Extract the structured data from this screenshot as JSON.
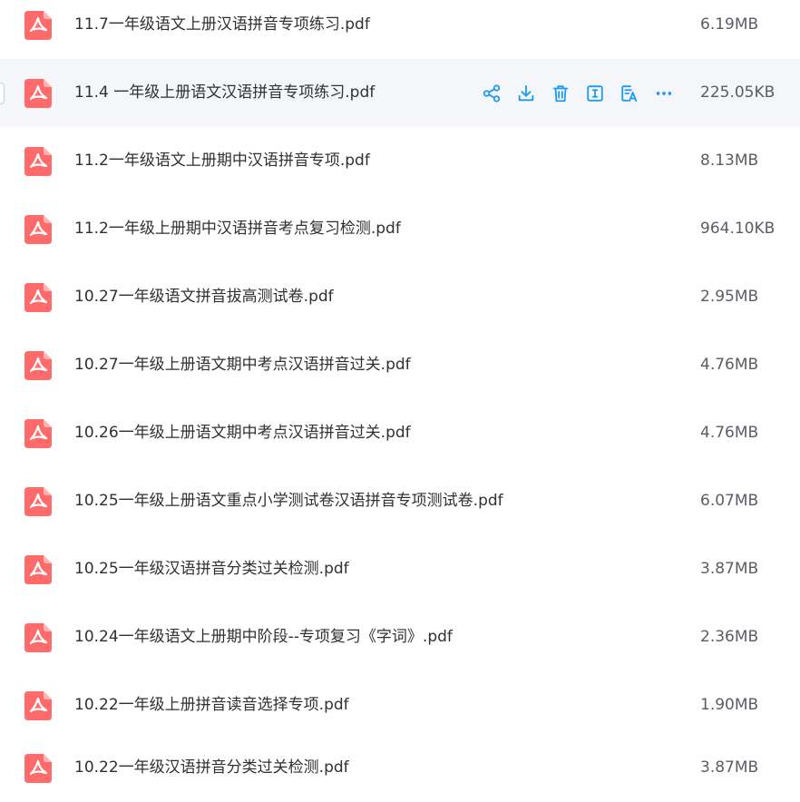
{
  "colors": {
    "pdf_icon": "#ff6b6b",
    "action_icon": "#1e9bf0",
    "hover_row": "#f5f6fa"
  },
  "icons": {
    "file": "pdf-icon",
    "actions": [
      "share-icon",
      "download-icon",
      "delete-icon",
      "rename-icon",
      "text-recognition-icon",
      "more-icon"
    ]
  },
  "files": [
    {
      "name": "11.7一年级语文上册汉语拼音专项练习.pdf",
      "size": "6.19MB"
    },
    {
      "name": "11.4 一年级上册语文汉语拼音专项练习.pdf",
      "size": "225.05KB"
    },
    {
      "name": "11.2一年级语文上册期中汉语拼音专项.pdf",
      "size": "8.13MB"
    },
    {
      "name": "11.2一年级上册期中汉语拼音考点复习检测.pdf",
      "size": "964.10KB"
    },
    {
      "name": "10.27一年级语文拼音拔高测试卷.pdf",
      "size": "2.95MB"
    },
    {
      "name": "10.27一年级上册语文期中考点汉语拼音过关.pdf",
      "size": "4.76MB"
    },
    {
      "name": "10.26一年级上册语文期中考点汉语拼音过关.pdf",
      "size": "4.76MB"
    },
    {
      "name": "10.25一年级上册语文重点小学测试卷汉语拼音专项测试卷.pdf",
      "size": "6.07MB"
    },
    {
      "name": "10.25一年级汉语拼音分类过关检测.pdf",
      "size": "3.87MB"
    },
    {
      "name": "10.24一年级语文上册期中阶段--专项复习《字词》.pdf",
      "size": "2.36MB"
    },
    {
      "name": "10.22一年级上册拼音读音选择专项.pdf",
      "size": "1.90MB"
    },
    {
      "name": "10.22一年级汉语拼音分类过关检测.pdf",
      "size": "3.87MB"
    }
  ]
}
